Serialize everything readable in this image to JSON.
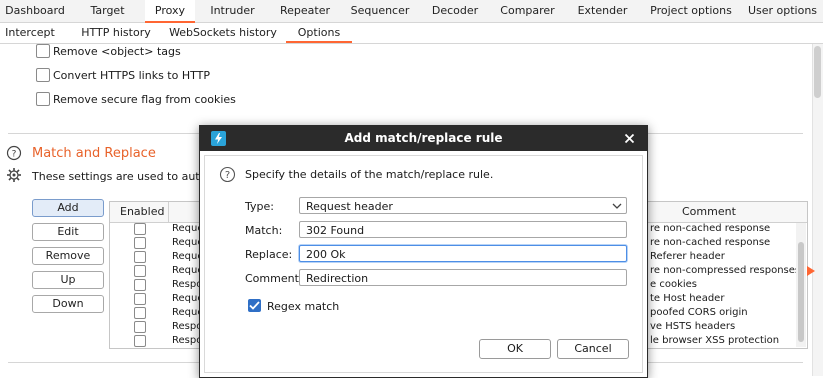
{
  "top_tabs": [
    "Dashboard",
    "Target",
    "Proxy",
    "Intruder",
    "Repeater",
    "Sequencer",
    "Decoder",
    "Comparer",
    "Extender",
    "Project options",
    "User options"
  ],
  "active_top_tab": "Proxy",
  "sub_tabs": [
    "Intercept",
    "HTTP history",
    "WebSockets history",
    "Options"
  ],
  "active_sub_tab": "Options",
  "options": [
    {
      "label": "Remove <object> tags",
      "checked": false
    },
    {
      "label": "Convert HTTPS links to HTTP",
      "checked": false
    },
    {
      "label": "Remove secure flag from cookies",
      "checked": false
    }
  ],
  "section": {
    "title": "Match and Replace",
    "description": "These settings are used to automatic"
  },
  "side_buttons": [
    "Add",
    "Edit",
    "Remove",
    "Up",
    "Down"
  ],
  "table": {
    "columns": {
      "enabled": "Enabled",
      "comment": "Comment"
    },
    "rows": [
      {
        "type": "Reque",
        "comment": "re non-cached response"
      },
      {
        "type": "Reque",
        "comment": "re non-cached response"
      },
      {
        "type": "Reque",
        "comment": "Referer header"
      },
      {
        "type": "Reque",
        "comment": "re non-compressed responses"
      },
      {
        "type": "Respo",
        "comment": "e cookies"
      },
      {
        "type": "Reque",
        "comment": "te Host header"
      },
      {
        "type": "Reque",
        "comment": "poofed CORS origin"
      },
      {
        "type": "Respo",
        "comment": "ve HSTS headers"
      },
      {
        "type": "Respo",
        "comment": "le browser XSS protection"
      }
    ]
  },
  "dialog": {
    "title": "Add match/replace rule",
    "description": "Specify the details of the match/replace rule.",
    "type_label": "Type:",
    "type_value": "Request header",
    "match_label": "Match:",
    "match_value": "302 Found",
    "replace_label": "Replace:",
    "replace_value": "200 Ok",
    "comment_label": "Comment:",
    "comment_value": "Redirection",
    "regex_label": "Regex match",
    "regex_checked": true,
    "ok_label": "OK",
    "cancel_label": "Cancel"
  },
  "colors": {
    "accent": "#ff6633",
    "section_title": "#e8622a",
    "dialog_title_bg": "#2b2b2b",
    "checkbox_checked": "#2f6fc6"
  }
}
